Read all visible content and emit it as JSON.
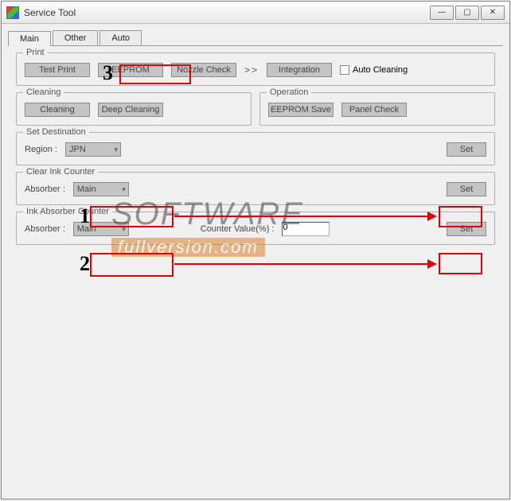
{
  "window": {
    "title": "Service Tool"
  },
  "tabs": {
    "main": "Main",
    "other": "Other",
    "auto": "Auto"
  },
  "print": {
    "title": "Print",
    "test_print": "Test Print",
    "eeprom": "EEPROM",
    "nozzle_check": "Nozzle Check",
    "integration": "Integration",
    "auto_cleaning": "Auto Cleaning",
    "arrow": ">>"
  },
  "cleaning": {
    "title": "Cleaning",
    "cleaning": "Cleaning",
    "deep_cleaning": "Deep Cleaning"
  },
  "operation": {
    "title": "Operation",
    "eeprom_save": "EEPROM Save",
    "panel_check": "Panel Check"
  },
  "set_destination": {
    "title": "Set Destination",
    "region_label": "Region :",
    "region_value": "JPN",
    "set": "Set"
  },
  "clear_ink": {
    "title": "Clear Ink Counter",
    "absorber_label": "Absorber :",
    "absorber_value": "Main",
    "set": "Set"
  },
  "ink_absorber": {
    "title": "Ink Absorber Counter",
    "absorber_label": "Absorber :",
    "absorber_value": "Main",
    "counter_label": "Counter Value(%) :",
    "counter_value": "0",
    "set": "Set"
  },
  "annotations": {
    "n1": "1",
    "n2": "2",
    "n3": "3"
  },
  "watermark": {
    "line1": "SOFTWARE",
    "line2": "fullversion.com"
  }
}
